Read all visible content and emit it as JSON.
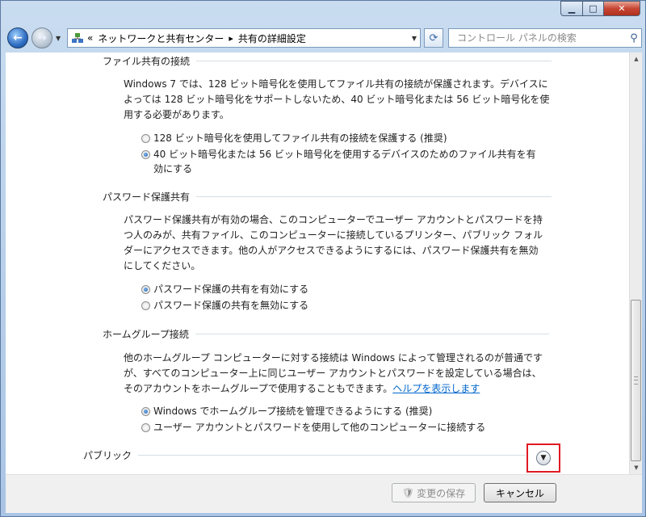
{
  "window": {
    "caption_min": "▁",
    "caption_max": "□",
    "caption_close": "✕"
  },
  "nav": {
    "breadcrumb_prefix": "«",
    "crumb1": "ネットワークと共有センター",
    "crumb_sep": "▸",
    "crumb2": "共有の詳細設定",
    "search_placeholder": "コントロール パネルの検索"
  },
  "sections": {
    "file_sharing": {
      "title": "ファイル共有の接続",
      "line1": "Windows 7 では、128 ビット暗号化を使用してファイル共有の接続が保護されます。デバイスに",
      "line2": "よっては 128 ビット暗号化をサポートしないため、40 ビット暗号化または 56 ビット暗号化を使",
      "line3": "用する必要があります。",
      "opt1": "128 ビット暗号化を使用してファイル共有の接続を保護する (推奨)",
      "opt2_line1": "40 ビット暗号化または 56 ビット暗号化を使用するデバイスのためのファイル共有を有",
      "opt2_line2": "効にする"
    },
    "password": {
      "title": "パスワード保護共有",
      "line1": "パスワード保護共有が有効の場合、このコンピューターでユーザー アカウントとパスワードを持",
      "line2": "つ人のみが、共有ファイル、このコンピューターに接続しているプリンター、パブリック フォル",
      "line3": "ダーにアクセスできます。他の人がアクセスできるようにするには、パスワード保護共有を無効",
      "line4": "にしてください。",
      "opt1": "パスワード保護の共有を有効にする",
      "opt2": "パスワード保護の共有を無効にする"
    },
    "homegroup": {
      "title": "ホームグループ接続",
      "line1": "他のホームグループ コンピューターに対する接続は Windows によって管理されるのが普通です",
      "line2": "が、すべてのコンピューター上に同じユーザー アカウントとパスワードを設定している場合は、",
      "line3": "そのアカウントをホームグループで使用することもできます。",
      "help_link": "ヘルプを表示します",
      "opt1": "Windows でホームグループ接続を管理できるようにする (推奨)",
      "opt2": "ユーザー アカウントとパスワードを使用して他のコンピューターに接続する"
    },
    "public": {
      "title": "パブリック"
    }
  },
  "footer": {
    "save_label": "変更の保存",
    "cancel_label": "キャンセル"
  }
}
